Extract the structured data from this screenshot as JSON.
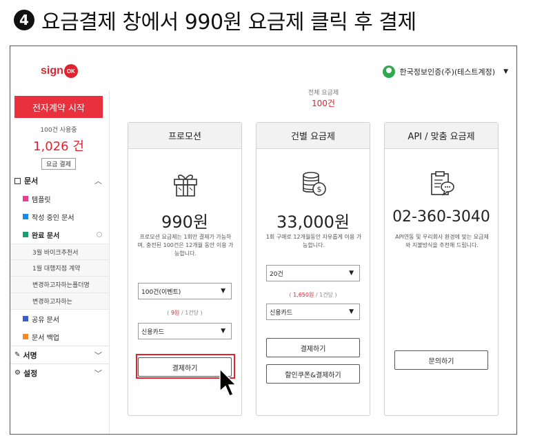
{
  "heading": {
    "step": "4",
    "text": "요금결제 창에서 990원 요금제 클릭 후 결제"
  },
  "topbar": {
    "logo_text": "sign",
    "logo_badge": "OK",
    "user_name": "한국정보인증(주)(테스트계정)"
  },
  "sidebar": {
    "start_button": "전자계약 시작",
    "usage_label": "100건 사용중",
    "usage_count": "1,026 건",
    "plan_button": "요금 결제",
    "sections": {
      "documents": "문서",
      "signature": "서명",
      "settings": "설정"
    },
    "items": [
      {
        "label": "템플릿",
        "color": "#e83e8c"
      },
      {
        "label": "작성 중인 문서",
        "color": "#1e88e5"
      },
      {
        "label": "완료 문서",
        "color": "#1e9e6e"
      },
      {
        "label": "공유 문서",
        "color": "#3a5fcd"
      },
      {
        "label": "문서 백업",
        "color": "#f08c2a"
      }
    ],
    "sub_items": [
      "3월 바이크추천서",
      "1월 대행지점 계약",
      "변경하고자하는폴더명",
      "변경하고자하는"
    ]
  },
  "main": {
    "top_caption": "전체 요금제",
    "top_count": "100건",
    "cards": [
      {
        "title": "프로모션",
        "icon": "gift-icon",
        "price": "990원",
        "desc": "프로모션 요금제는 1회만 결제가 가능하며, 충전된 100건은 12개월 동안 이용 가능합니다.",
        "select1": "100건(이벤트)",
        "unit_price": "9원",
        "unit_suffix": " / 1건당",
        "select2": "신용카드",
        "button": "결제하기"
      },
      {
        "title": "건별 요금제",
        "icon": "coins-icon",
        "price": "33,000원",
        "desc": "1회 구매로 12개월동안 자유롭게 이용 가능합니다.",
        "select1": "20건",
        "unit_price": "1,650원",
        "unit_suffix": " / 1건당",
        "select2": "신용카드",
        "button": "결제하기",
        "button2": "할인쿠폰&결제하기"
      },
      {
        "title": "API / 맞춤 요금제",
        "icon": "clipboard-chat-icon",
        "price": "02-360-3040",
        "desc": "API연동 및 우리회사 환경에 맞는 요금제와 지불방식을 추천해 드립니다.",
        "button": "문의하기"
      }
    ]
  },
  "colors": {
    "brand_red": "#e0222f",
    "accent_red": "#e8313d"
  }
}
